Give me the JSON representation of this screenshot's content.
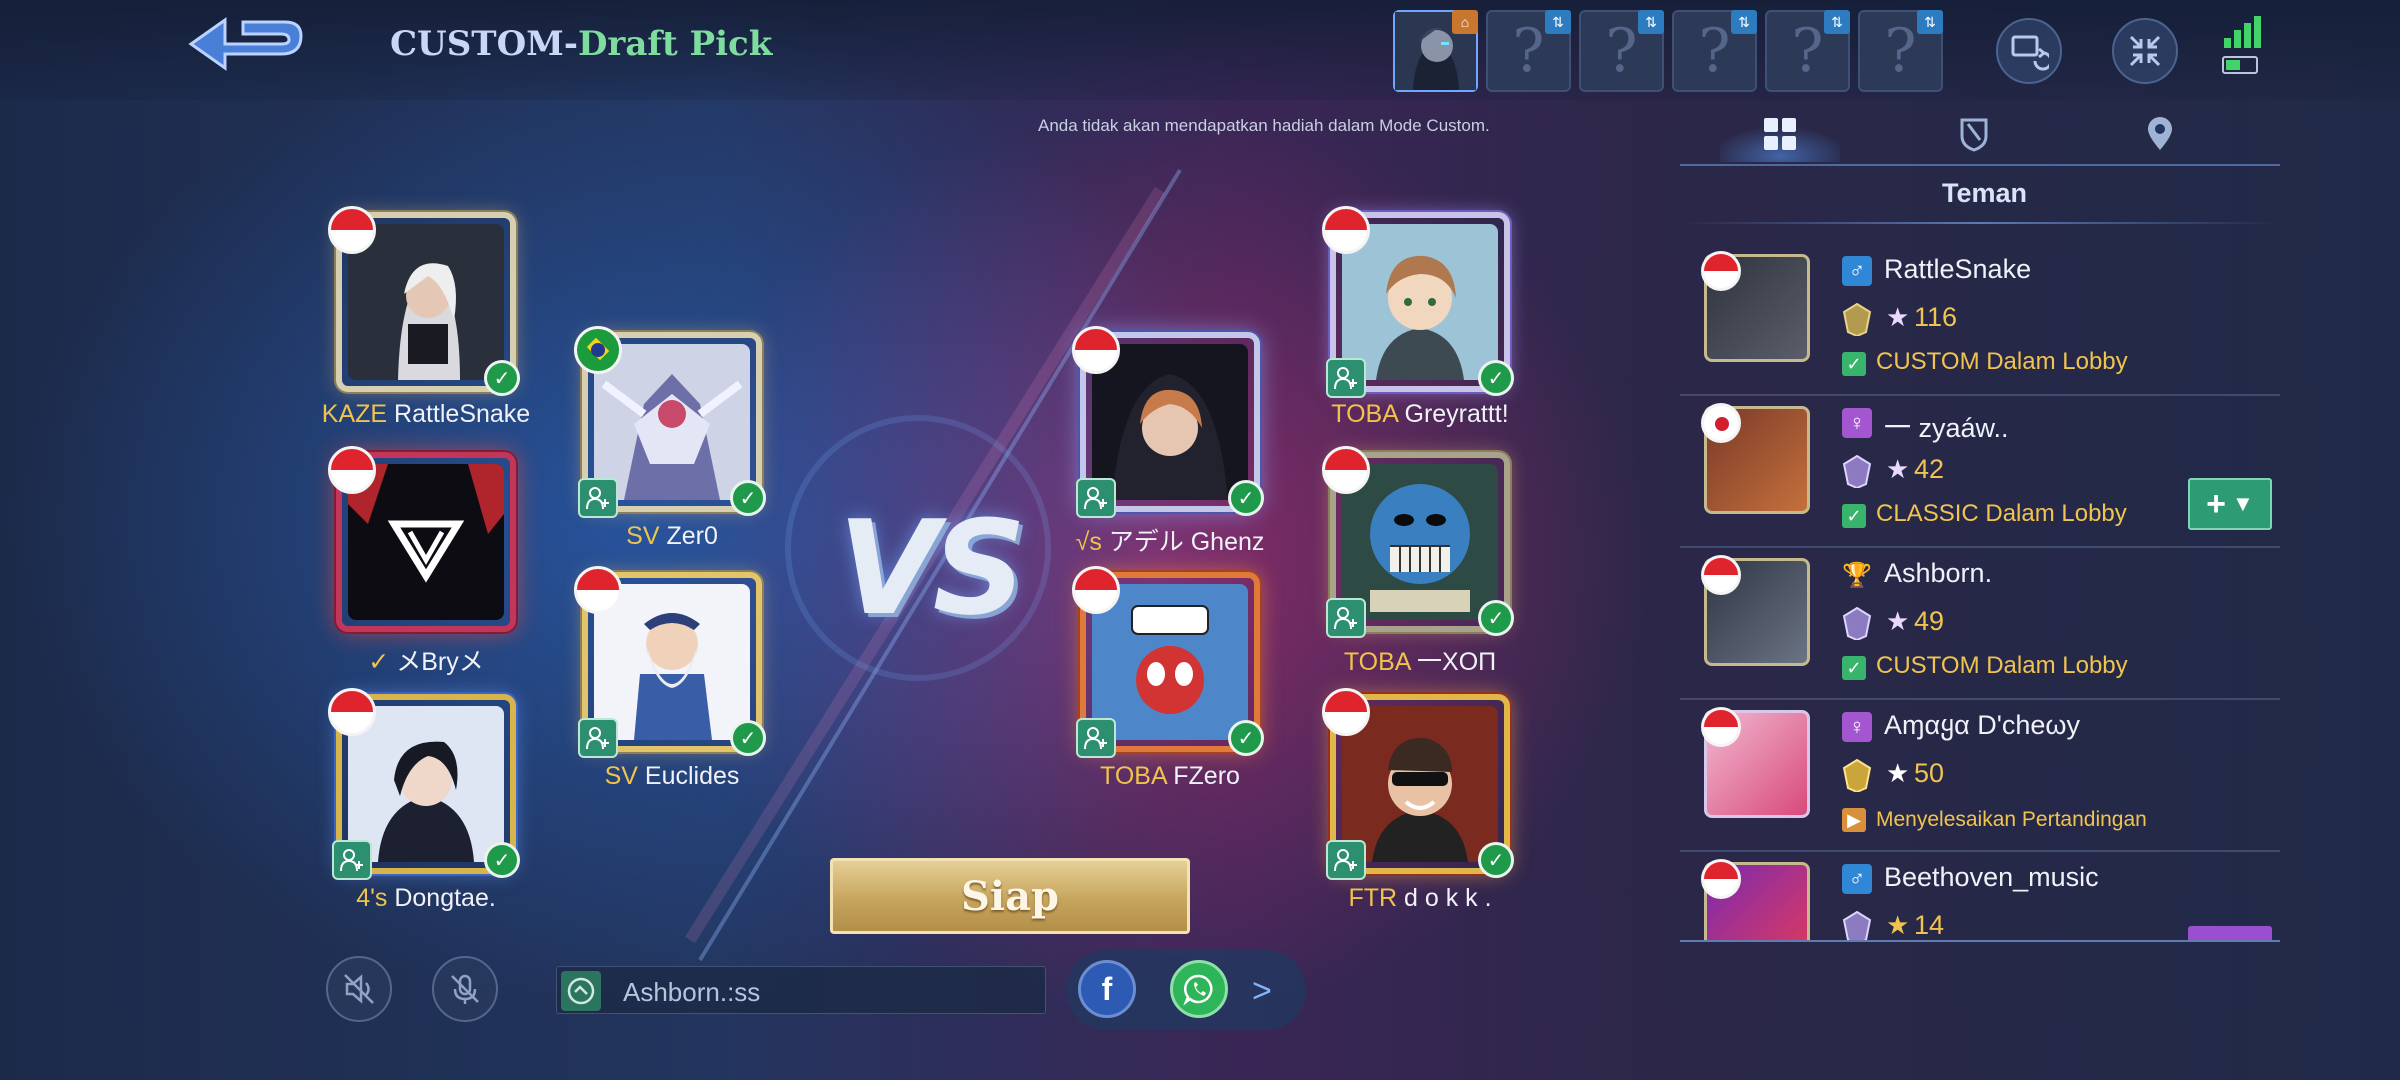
{
  "header": {
    "title_prefix": "CUSTOM-",
    "title_mode": "Draft Pick",
    "notice": "Anda tidak akan mendapatkan hadiah dalam Mode Custom.",
    "pick_slots": [
      "?",
      "?",
      "?",
      "?",
      "?"
    ]
  },
  "team_left": [
    {
      "tag": "KAZE",
      "name": "RattleSnake",
      "flag": "id"
    },
    {
      "tag": "SV",
      "name": "Zer0",
      "flag": "br"
    },
    {
      "tag": "✓",
      "name": "メBryメ",
      "flag": "id"
    },
    {
      "tag": "SV",
      "name": "Euclides",
      "flag": "id"
    },
    {
      "tag": "4's",
      "name": "Dongtae.",
      "flag": "id"
    }
  ],
  "team_right": [
    {
      "tag": "TOBA",
      "name": "Greyrattt!",
      "flag": "id"
    },
    {
      "tag": "√s",
      "name": "アデル Ghenz",
      "flag": "sg"
    },
    {
      "tag": "TOBA",
      "name": "一XOП",
      "flag": "id"
    },
    {
      "tag": "TOBA",
      "name": "FZero",
      "flag": "id"
    },
    {
      "tag": "FTR",
      "name": "d o k k .",
      "flag": "id"
    }
  ],
  "vs_label": "VS",
  "ready_button": "Siap",
  "chat": {
    "value": "Ashborn.:ss"
  },
  "friends_panel": {
    "subtitle": "Teman",
    "friends": [
      {
        "gender": "♂",
        "name": "RattleSnake",
        "points": "116",
        "status_mode": "CUSTOM",
        "status_text": "CUSTOM Dalam Lobby",
        "flag": "id"
      },
      {
        "gender": "♀",
        "name": "一 zyaáw..",
        "points": "42",
        "status_mode": "CLASSIC",
        "status_text": "CLASSIC Dalam Lobby",
        "flag": "jp"
      },
      {
        "gender": "🏆",
        "name": "Ashborn.",
        "points": "49",
        "status_mode": "CUSTOM",
        "status_text": "CUSTOM Dalam Lobby",
        "flag": "id"
      },
      {
        "gender": "♀",
        "name": "Aɱαყα D'cheωy",
        "points": "50",
        "status_mode": "",
        "status_text": "Menyelesaikan Pertandingan",
        "flag": "id"
      },
      {
        "gender": "♂",
        "name": "Beethoven_music",
        "points": "14",
        "status_mode": "",
        "status_text": "",
        "flag": "id"
      }
    ]
  },
  "colors": {
    "accent_gold": "#f0c34a",
    "ready_gold": "#c7a55f",
    "check_green": "#1e9a4a",
    "title_green": "#7fdc9f"
  }
}
